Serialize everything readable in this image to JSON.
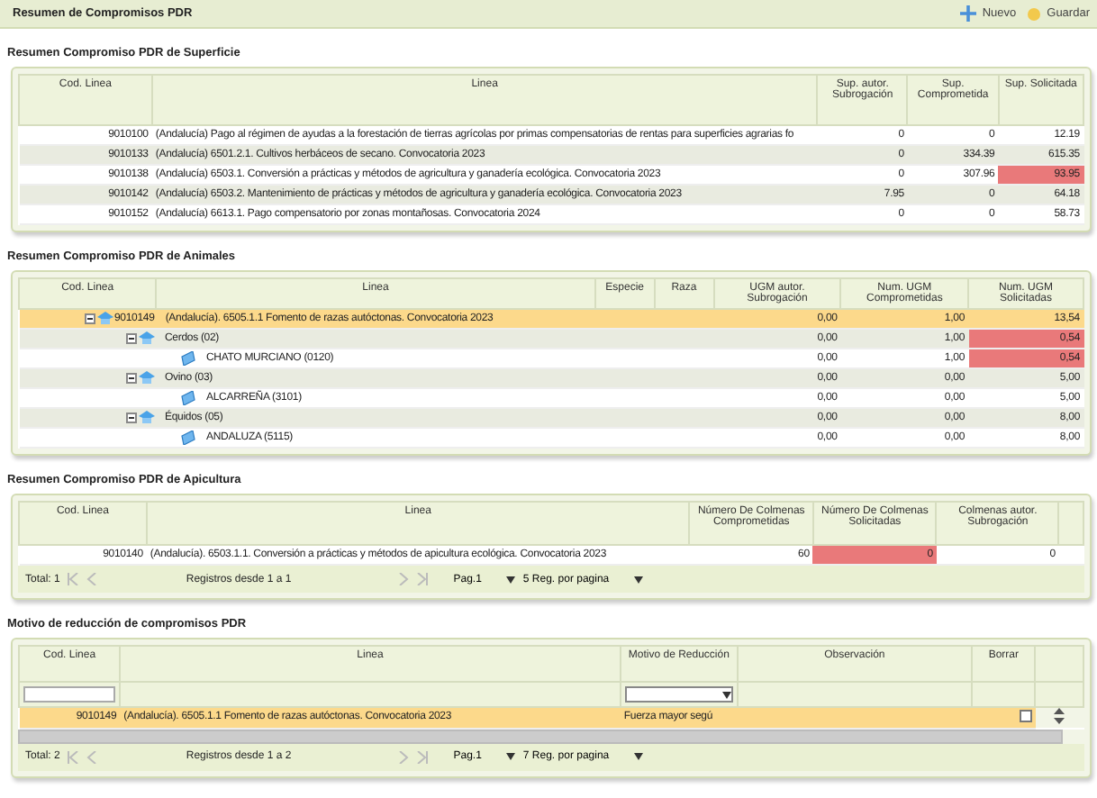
{
  "header": {
    "title": "Resumen de Compromisos PDR",
    "actions": [
      {
        "kind": "new",
        "label": "Nuevo"
      },
      {
        "kind": "save",
        "label": "Guardar"
      }
    ]
  },
  "superficie": {
    "title": "Resumen Compromiso PDR de Superficie",
    "columns": [
      "Cod. Linea",
      "Linea",
      "Sup. autor. Subrogación",
      "Sup. Comprometida",
      "Sup. Solicitada"
    ],
    "rows": [
      {
        "cod": "9010100",
        "linea": "(Andalucía) Pago al régimen de ayudas a la forestación de tierras agrícolas por primas compensatorias de rentas para superficies agrarias fo",
        "values": [
          {
            "text": "0",
            "alert": false
          },
          {
            "text": "0",
            "alert": false
          },
          {
            "text": "12.19",
            "alert": false
          }
        ]
      },
      {
        "cod": "9010133",
        "linea": "(Andalucía) 6501.2.1. Cultivos herbáceos de secano. Convocatoria 2023",
        "values": [
          {
            "text": "0",
            "alert": false
          },
          {
            "text": "334.39",
            "alert": false
          },
          {
            "text": "615.35",
            "alert": false
          }
        ]
      },
      {
        "cod": "9010138",
        "linea": "(Andalucía) 6503.1. Conversión a prácticas y métodos de agricultura y ganadería ecológica. Convocatoria 2023",
        "values": [
          {
            "text": "0",
            "alert": false
          },
          {
            "text": "307.96",
            "alert": false
          },
          {
            "text": "93.95",
            "alert": true
          }
        ]
      },
      {
        "cod": "9010142",
        "linea": "(Andalucía) 6503.2. Mantenimiento de prácticas y métodos de agricultura y ganadería ecológica. Convocatoria 2023",
        "values": [
          {
            "text": "7.95",
            "alert": false
          },
          {
            "text": "0",
            "alert": false
          },
          {
            "text": "64.18",
            "alert": false
          }
        ]
      },
      {
        "cod": "9010152",
        "linea": "(Andalucía) 6613.1. Pago compensatorio por zonas montañosas. Convocatoria 2024",
        "values": [
          {
            "text": "0",
            "alert": false
          },
          {
            "text": "0",
            "alert": false
          },
          {
            "text": "58.73",
            "alert": false
          }
        ]
      }
    ]
  },
  "animales": {
    "title": "Resumen Compromiso PDR de Animales",
    "columns": [
      "Cod. Linea",
      "Linea",
      "Especie",
      "Raza",
      "UGM autor. Subrogación",
      "Num. UGM Comprometidas",
      "Num. UGM Solicitadas"
    ],
    "rows": [
      {
        "code": "9010149",
        "label": "(Andalucía). 6505.1.1 Fomento de razas autóctonas. Convocatoria 2023",
        "expanded": true,
        "selected": true,
        "values": [
          {
            "text": "0,00",
            "alert": false
          },
          {
            "text": "1,00",
            "alert": false
          },
          {
            "text": "13,54",
            "alert": false
          }
        ],
        "children": [
          {
            "label": "Cerdos (02)",
            "expanded": true,
            "selected": false,
            "values": [
              {
                "text": "0,00",
                "alert": false
              },
              {
                "text": "1,00",
                "alert": false
              },
              {
                "text": "0,54",
                "alert": true
              }
            ],
            "children": [
              {
                "label": "CHATO MURCIANO (0120)",
                "selected": false,
                "values": [
                  {
                    "text": "0,00",
                    "alert": false
                  },
                  {
                    "text": "1,00",
                    "alert": false
                  },
                  {
                    "text": "0,54",
                    "alert": true
                  }
                ]
              }
            ]
          },
          {
            "label": "Ovino (03)",
            "expanded": true,
            "selected": false,
            "values": [
              {
                "text": "0,00",
                "alert": false
              },
              {
                "text": "0,00",
                "alert": false
              },
              {
                "text": "5,00",
                "alert": false
              }
            ],
            "children": [
              {
                "label": "ALCARREÑA (3101)",
                "selected": false,
                "values": [
                  {
                    "text": "0,00",
                    "alert": false
                  },
                  {
                    "text": "0,00",
                    "alert": false
                  },
                  {
                    "text": "5,00",
                    "alert": false
                  }
                ]
              }
            ]
          },
          {
            "label": "Équidos (05)",
            "expanded": true,
            "selected": false,
            "values": [
              {
                "text": "0,00",
                "alert": false
              },
              {
                "text": "0,00",
                "alert": false
              },
              {
                "text": "8,00",
                "alert": false
              }
            ],
            "children": [
              {
                "label": "ANDALUZA (5115)",
                "selected": false,
                "values": [
                  {
                    "text": "0,00",
                    "alert": false
                  },
                  {
                    "text": "0,00",
                    "alert": false
                  },
                  {
                    "text": "8,00",
                    "alert": false
                  }
                ]
              }
            ]
          }
        ]
      }
    ]
  },
  "apicultura": {
    "title": "Resumen Compromiso PDR de Apicultura",
    "columns": [
      "Cod. Linea",
      "Linea",
      "Número De Colmenas Comprometidas",
      "Número De Colmenas Solicitadas",
      "Colmenas autor. Subrogación"
    ],
    "rows": [
      {
        "cod": "9010140",
        "linea": "(Andalucía). 6503.1.1. Conversión a prácticas y métodos de apicultura ecológica. Convocatoria 2023",
        "values": [
          {
            "text": "60",
            "alert": false
          },
          {
            "text": "0",
            "alert": true
          },
          {
            "text": "0",
            "alert": false
          }
        ]
      }
    ],
    "pager": {
      "total": "Total: 1",
      "range": "Registros desde 1 a 1",
      "page": "Pag.1",
      "per_page": "5 Reg. por pagina"
    }
  },
  "reduccion": {
    "title": "Motivo de reducción de compromisos PDR",
    "columns": [
      "Cod. Linea",
      "Linea",
      "Motivo de Reducción",
      "Observación",
      "Borrar"
    ],
    "rows": [
      {
        "cod": "9010149",
        "linea": "(Andalucía). 6505.1.1 Fomento de razas autóctonas. Convocatoria 2023",
        "motivo": "Fuerza mayor segú",
        "selected": true,
        "borrar": false
      }
    ],
    "pager": {
      "total": "Total: 2",
      "range": "Registros desde 1 a 2",
      "page": "Pag.1",
      "per_page": "7 Reg. por pagina"
    }
  }
}
